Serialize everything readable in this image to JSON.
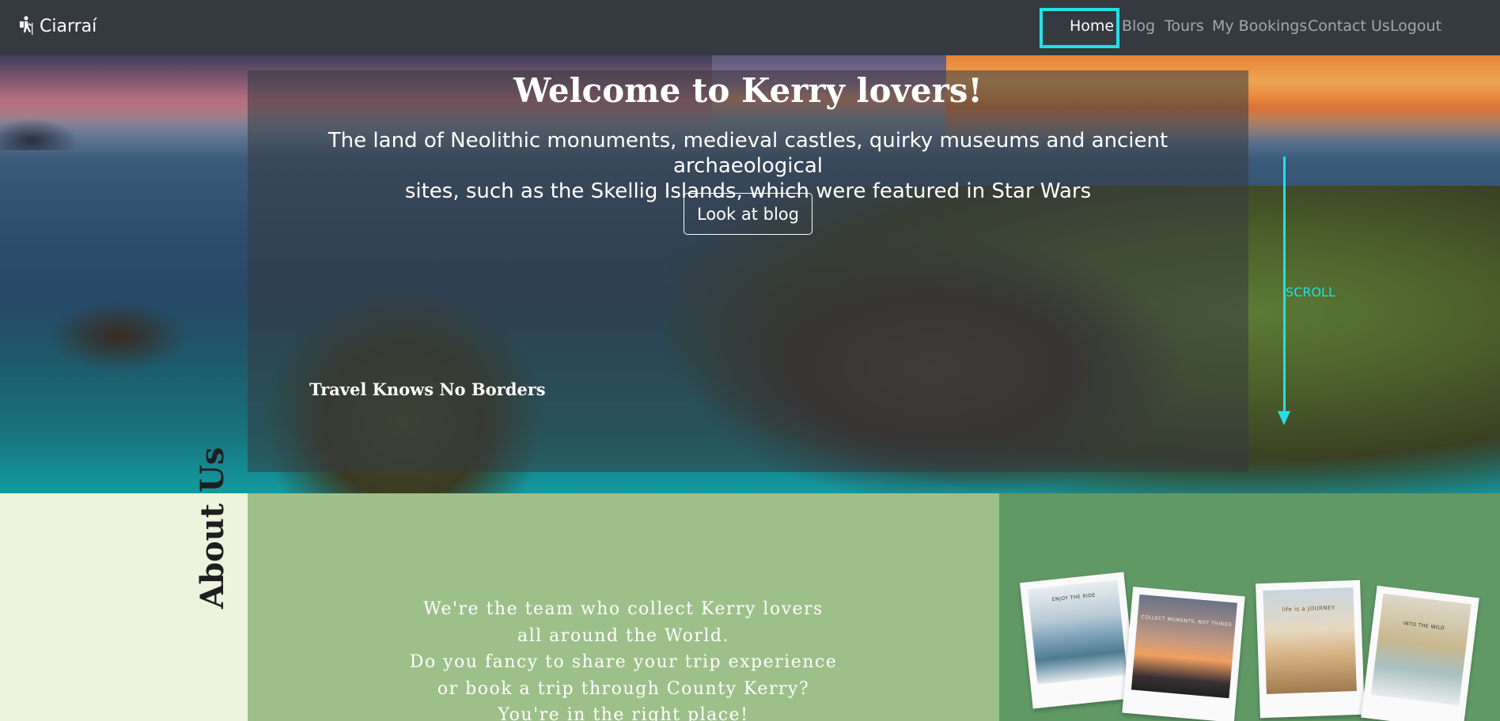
{
  "nav": {
    "brand": "Ciarraí",
    "brand_icon": "hiker-icon",
    "items": [
      {
        "label": "Home",
        "active": true
      },
      {
        "label": "Blog"
      },
      {
        "label": "Tours"
      },
      {
        "label": "My Bookings"
      },
      {
        "label": "Contact Us"
      },
      {
        "label": "Logout"
      }
    ]
  },
  "hero": {
    "title": "Welcome to Kerry lovers!",
    "subtitle_line1": "The land of Neolithic monuments, medieval castles, quirky museums and ancient archaeological",
    "subtitle_line2": "sites, such as the Skellig Islands, which were featured in Star Wars",
    "button_label": "Look at blog",
    "tagline": "Travel Knows No Borders",
    "scroll_label": "SCROLL"
  },
  "about": {
    "heading": "About Us",
    "lines": [
      "We're the team who collect Kerry lovers",
      "all around the World.",
      "Do you fancy to share your trip experience",
      "or book a trip through County Kerry?",
      "You're in the right place!"
    ],
    "polaroid_captions": [
      "ENJOY THE RIDE",
      "COLLECT MOMENTS, NOT THINGS",
      "life is a JOURNEY",
      "INTO THE WILD"
    ]
  },
  "colors": {
    "navbar": "#343a40",
    "highlight": "#22e0e6",
    "about_left": "#edf3dc",
    "about_mid": "#9dc08b",
    "about_right": "#609966"
  }
}
